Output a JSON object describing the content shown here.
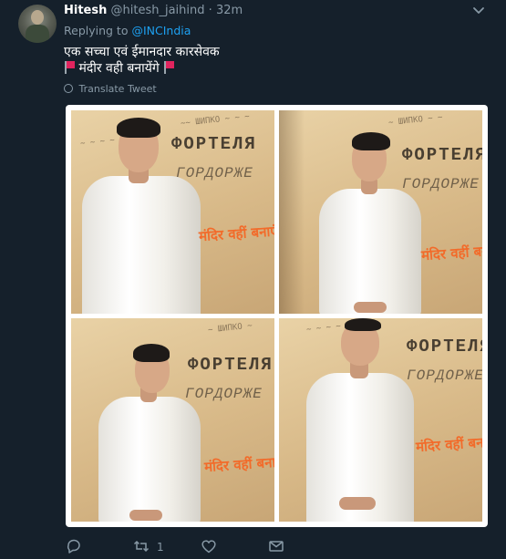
{
  "tweet": {
    "author_name": "Hitesh",
    "handle": "@hitesh_jaihind",
    "separator": "·",
    "time": "32m",
    "replying_prefix": "Replying to",
    "replying_to": "@INCIndia",
    "text_line1": "एक सच्चा एवं ईमानदार कारसेवक",
    "text_line2": "मंदीर वही बनायेंगे",
    "translate_label": "Translate Tweet"
  },
  "media": {
    "overlay_1": "मंदिर वहीं बनाएंगे",
    "overlay_2": "मंदिर वहीं बनाएंगे",
    "overlay_3": "मंदिर वहीं बनाएंगे",
    "overlay_4": "मंदिर वहीं बनाएंगे",
    "wall_word_1": "ФОРТЕЛЯ",
    "wall_word_2": "ГОРДОРЖЕ"
  },
  "actions": {
    "retweet_count": "1"
  },
  "colors": {
    "background": "#15202b",
    "accent": "#1da1f2",
    "muted": "#8899a6",
    "flag": "#e0245e",
    "overlay_text": "#f26b2a"
  },
  "icons": [
    "reply-icon",
    "retweet-icon",
    "like-icon",
    "dm-icon",
    "chevron-down-icon",
    "globe-icon",
    "flag-icon"
  ]
}
